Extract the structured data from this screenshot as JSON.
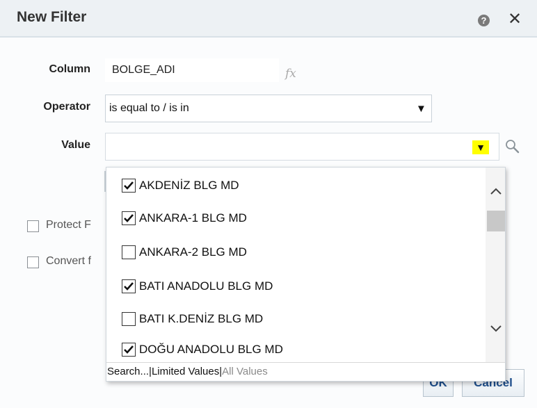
{
  "dialog": {
    "title": "New Filter",
    "help_icon": "question-icon",
    "close_icon": "close-icon",
    "help_glyph": "?",
    "close_glyph": "✕"
  },
  "form": {
    "column_label": "Column",
    "column_value": "BOLGE_ADI",
    "fx_label": "fx",
    "operator_label": "Operator",
    "operator_value": "is equal to / is in",
    "value_label": "Value",
    "value_current": "",
    "dropdown_glyph": "▼",
    "dropdown_highlight_color": "#ffff00"
  },
  "options": {
    "protect_label": "Protect F",
    "convert_label": "Convert f"
  },
  "dropdown_list": {
    "items": [
      {
        "label": "AKDENİZ BLG MD",
        "checked": true
      },
      {
        "label": "ANKARA-1 BLG MD",
        "checked": true
      },
      {
        "label": "ANKARA-2 BLG MD",
        "checked": false
      },
      {
        "label": "BATI ANADOLU BLG MD",
        "checked": true
      },
      {
        "label": "BATI K.DENİZ BLG MD",
        "checked": false
      },
      {
        "label": "DOĞU ANADOLU BLG MD",
        "checked": true
      }
    ],
    "footer": {
      "search": "Search...",
      "separator": "|",
      "limited": "Limited Values",
      "all": "All Values"
    }
  },
  "buttons": {
    "ok": "OK",
    "cancel": "Cancel"
  }
}
